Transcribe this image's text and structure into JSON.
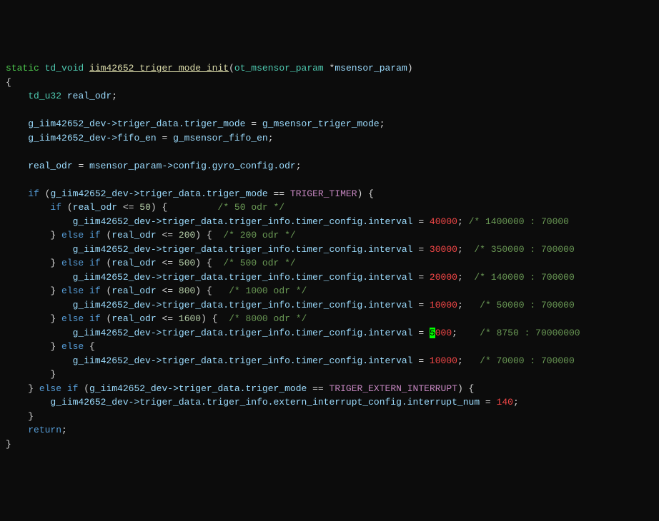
{
  "code": {
    "l1": {
      "kw_static": "static",
      "type_void": "td_void",
      "fn": "iim42652_triger_mode_init",
      "p_open": "(",
      "type_param": "ot_msensor_param",
      "deref": " *",
      "param": "msensor_param",
      "p_close": ")"
    },
    "l2": {
      "brace": "{"
    },
    "l3": {
      "indent": "    ",
      "type": "td_u32",
      "sp": " ",
      "var": "real_odr",
      "semi": ";"
    },
    "l4": {
      "blank": ""
    },
    "l5": {
      "indent": "    ",
      "lhs": "g_iim42652_dev->triger_data.triger_mode",
      "eq": " = ",
      "rhs": "g_msensor_triger_mode",
      "semi": ";"
    },
    "l6": {
      "indent": "    ",
      "lhs": "g_iim42652_dev->fifo_en",
      "eq": " = ",
      "rhs": "g_msensor_fifo_en",
      "semi": ";"
    },
    "l7": {
      "blank": ""
    },
    "l8": {
      "indent": "    ",
      "lhs": "real_odr",
      "eq": " = ",
      "rhs": "msensor_param->config.gyro_config.odr",
      "semi": ";"
    },
    "l9": {
      "blank": ""
    },
    "l10": {
      "indent": "    ",
      "kw": "if",
      "sp": " (",
      "expr": "g_iim42652_dev->triger_data.triger_mode",
      "op": " == ",
      "macro": "TRIGER_TIMER",
      "close": ") {"
    },
    "l11": {
      "indent": "        ",
      "kw": "if",
      "sp": " (",
      "var": "real_odr",
      "op": " <= ",
      "num": "50",
      "close": ") {",
      "pad": "         ",
      "cmt": "/* 50 odr */"
    },
    "l12": {
      "indent": "            ",
      "lhs": "g_iim42652_dev->triger_data.triger_info.timer_config.interval",
      "eq": " = ",
      "num": "40000",
      "semi": ";",
      "pad": " ",
      "cmt": "/* 1400000 : 70000"
    },
    "l13": {
      "indent": "        ",
      "close": "} ",
      "kw": "else if",
      "sp": " (",
      "var": "real_odr",
      "op": " <= ",
      "num": "200",
      "close2": ") {",
      "pad": "  ",
      "cmt": "/* 200 odr */"
    },
    "l14": {
      "indent": "            ",
      "lhs": "g_iim42652_dev->triger_data.triger_info.timer_config.interval",
      "eq": " = ",
      "num": "30000",
      "semi": ";",
      "pad": "  ",
      "cmt": "/* 350000 : 700000"
    },
    "l15": {
      "indent": "        ",
      "close": "} ",
      "kw": "else if",
      "sp": " (",
      "var": "real_odr",
      "op": " <= ",
      "num": "500",
      "close2": ") {",
      "pad": "  ",
      "cmt": "/* 500 odr */"
    },
    "l16": {
      "indent": "            ",
      "lhs": "g_iim42652_dev->triger_data.triger_info.timer_config.interval",
      "eq": " = ",
      "num": "20000",
      "semi": ";",
      "pad": "  ",
      "cmt": "/* 140000 : 700000"
    },
    "l17": {
      "indent": "        ",
      "close": "} ",
      "kw": "else if",
      "sp": " (",
      "var": "real_odr",
      "op": " <= ",
      "num": "800",
      "close2": ") {",
      "pad": "   ",
      "cmt": "/* 1000 odr */"
    },
    "l18": {
      "indent": "            ",
      "lhs": "g_iim42652_dev->triger_data.triger_info.timer_config.interval",
      "eq": " = ",
      "num": "10000",
      "semi": ";",
      "pad": "   ",
      "cmt": "/* 50000 : 700000"
    },
    "l19": {
      "indent": "        ",
      "close": "} ",
      "kw": "else if",
      "sp": " (",
      "var": "real_odr",
      "op": " <= ",
      "num": "1600",
      "close2": ") {",
      "pad": "  ",
      "cmt": "/* 8000 odr */"
    },
    "l20": {
      "indent": "            ",
      "lhs": "g_iim42652_dev->triger_data.triger_info.timer_config.interval",
      "eq": " = ",
      "num_a": "5",
      "num_b": "000",
      "semi": ";",
      "pad": "    ",
      "cmt": "/* 8750 : 70000000"
    },
    "l21": {
      "indent": "        ",
      "close": "} ",
      "kw": "else",
      "sp": " {"
    },
    "l22": {
      "indent": "            ",
      "lhs": "g_iim42652_dev->triger_data.triger_info.timer_config.interval",
      "eq": " = ",
      "num": "10000",
      "semi": ";",
      "pad": "   ",
      "cmt": "/* 70000 : 700000"
    },
    "l23": {
      "indent": "        ",
      "close": "}"
    },
    "l24": {
      "indent": "    ",
      "close": "} ",
      "kw": "else if",
      "sp": " (",
      "expr": "g_iim42652_dev->triger_data.triger_mode",
      "op": " == ",
      "macro": "TRIGER_EXTERN_INTERRUPT",
      "close2": ") {"
    },
    "l25": {
      "indent": "        ",
      "lhs": "g_iim42652_dev->triger_data.triger_info.extern_interrupt_config.interrupt_num",
      "eq": " = ",
      "num": "140",
      "semi": ";"
    },
    "l26": {
      "indent": "    ",
      "close": "}"
    },
    "l27": {
      "indent": "    ",
      "kw": "return",
      "semi": ";"
    },
    "l28": {
      "brace": "}"
    }
  }
}
